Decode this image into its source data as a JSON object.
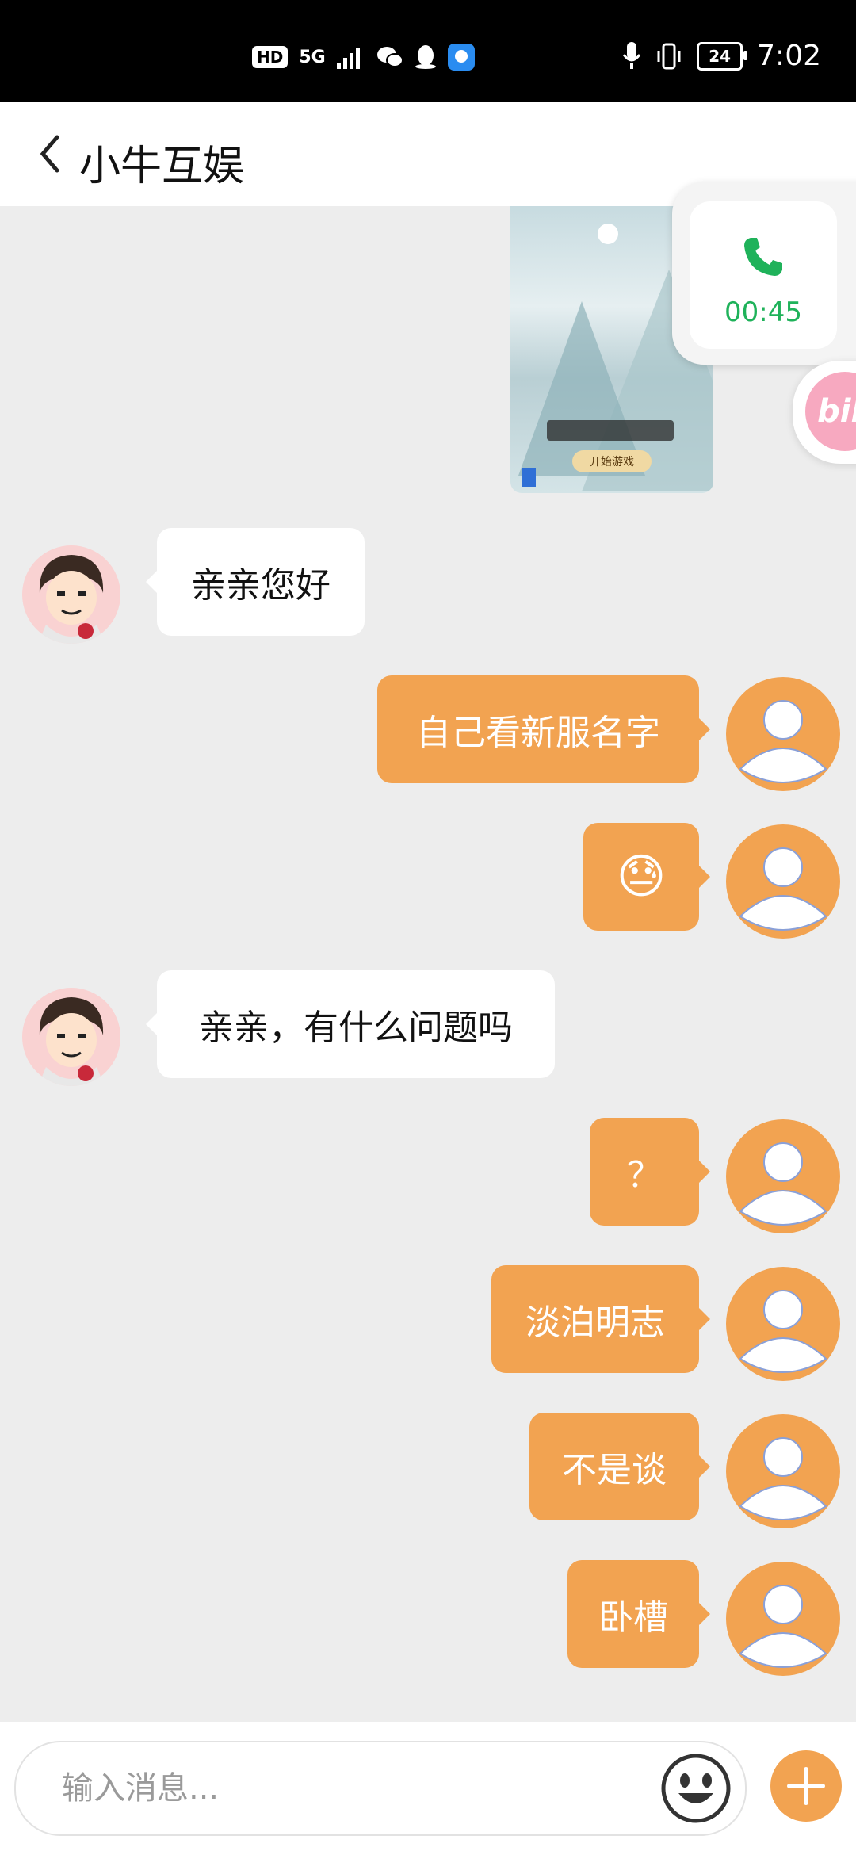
{
  "status_bar": {
    "hd": "HD",
    "network": "5G",
    "battery": "24",
    "time": "7:02"
  },
  "header": {
    "title": "小牛互娱"
  },
  "call_float": {
    "duration": "00:45"
  },
  "bili_float": {
    "label": "bili"
  },
  "game_image": {
    "start_label": "开始游戏"
  },
  "messages": [
    {
      "from": "agent",
      "text": "亲亲您好"
    },
    {
      "from": "user",
      "text": "自己看新服名字"
    },
    {
      "from": "user",
      "text": "😓"
    },
    {
      "from": "agent",
      "text": "亲亲，有什么问题吗"
    },
    {
      "from": "user",
      "text": "？"
    },
    {
      "from": "user",
      "text": "淡泊明志"
    },
    {
      "from": "user",
      "text": "不是谈"
    },
    {
      "from": "user",
      "text": "卧槽"
    }
  ],
  "input": {
    "placeholder": "输入消息..."
  },
  "colors": {
    "accent": "#f2a351",
    "call_green": "#1fb25a",
    "background": "#ededed"
  }
}
